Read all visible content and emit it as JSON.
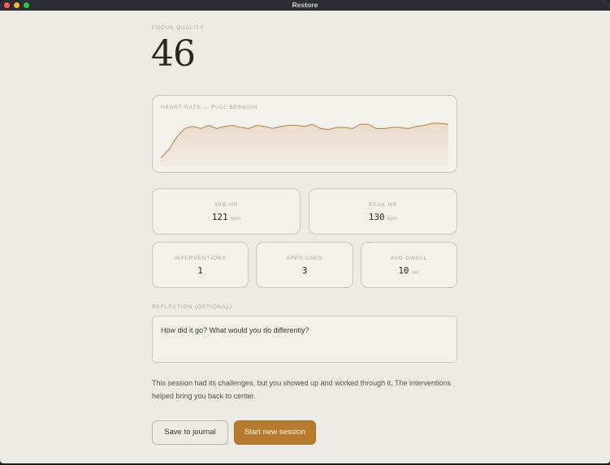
{
  "window": {
    "title": "Restore"
  },
  "focus": {
    "label": "FOCUS QUALITY",
    "score": "46"
  },
  "heart_rate": {
    "label": "HEART RATE — FULL SESSION",
    "line_color": "#bf8740",
    "values": [
      92,
      100,
      112,
      120,
      122,
      120,
      123,
      120,
      122,
      123,
      121,
      120,
      123,
      122,
      120,
      122,
      123,
      123,
      122,
      124,
      120,
      119,
      121,
      121,
      120,
      124,
      124,
      120,
      120,
      121,
      121,
      120,
      122,
      123,
      125,
      125,
      124
    ]
  },
  "stats_top": [
    {
      "label": "AVG HR",
      "value": "121",
      "unit": "bpm"
    },
    {
      "label": "PEAK HR",
      "value": "130",
      "unit": "bpm"
    }
  ],
  "stats_bottom": [
    {
      "label": "INTERVENTIONS",
      "value": "1"
    },
    {
      "label": "APPS USED",
      "value": "3"
    },
    {
      "label": "AVG DWELL",
      "value": "10",
      "unit": "sec"
    }
  ],
  "reflection": {
    "label": "REFLECTION (OPTIONAL)",
    "placeholder": "How did it go? What would you do differently?"
  },
  "message": "This session had its challenges, but you showed up and worked through it. The interventions helped bring you back to center.",
  "buttons": {
    "save": "Save to journal",
    "start": "Start new session"
  },
  "colors": {
    "accent": "#b87a2e",
    "background": "#ecebe6",
    "card": "#f2f1ec"
  }
}
